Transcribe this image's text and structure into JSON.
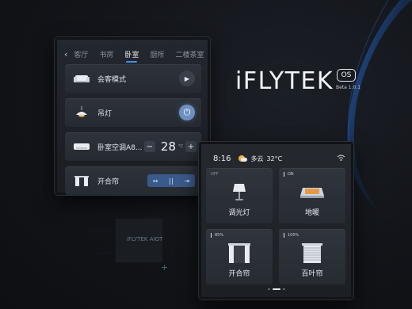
{
  "left_panel": {
    "tabs": [
      "客厅",
      "书房",
      "卧室",
      "厨所",
      "二楼茶室"
    ],
    "active_tab": 2,
    "rows": [
      {
        "name": "scene-row",
        "label": "会客模式",
        "icon": "sofa-icon",
        "control": "play-button"
      },
      {
        "name": "ceiling-light-row",
        "label": "吊灯",
        "icon": "pendant-lamp-icon",
        "control": "power-button"
      },
      {
        "name": "ac-row",
        "label": "卧室空调A8...",
        "icon": "air-conditioner-icon",
        "temperature": "28",
        "unit": "°C",
        "minus": "−",
        "plus": "+"
      },
      {
        "name": "curtain-row",
        "label": "开合帘",
        "icon": "curtain-icon",
        "controls": [
          "↔",
          "||",
          "⇥"
        ]
      }
    ]
  },
  "brand": {
    "logo": "iFLYTEK",
    "os_badge": "OS",
    "version": "Beta 1.0.1"
  },
  "aiot": {
    "label": "iFLYTEK AIOT"
  },
  "right_panel": {
    "status": {
      "time": "8:16",
      "weather_icon": "partly-cloudy-icon",
      "weather": "多云",
      "temperature": "32°C",
      "wifi_icon": "wifi-icon"
    },
    "tiles": [
      {
        "name": "tile-dimmer-lamp",
        "state": "OFF",
        "label": "调光灯",
        "icon": "table-lamp-icon"
      },
      {
        "name": "tile-floor-heating",
        "state": "ON",
        "label": "地暖",
        "icon": "floor-heater-icon"
      },
      {
        "name": "tile-curtain",
        "state": "85%",
        "label": "开合帘",
        "icon": "curtain-icon"
      },
      {
        "name": "tile-blinds",
        "state": "100%",
        "label": "百叶帘",
        "icon": "blinds-icon"
      }
    ],
    "page_indicator": {
      "current": 2,
      "total": 3
    }
  },
  "colors": {
    "background": "#121419",
    "accent_blue": "#3f8ef5",
    "power_active": "#6e8fc2",
    "curtain_control": "#3a5a8c"
  }
}
